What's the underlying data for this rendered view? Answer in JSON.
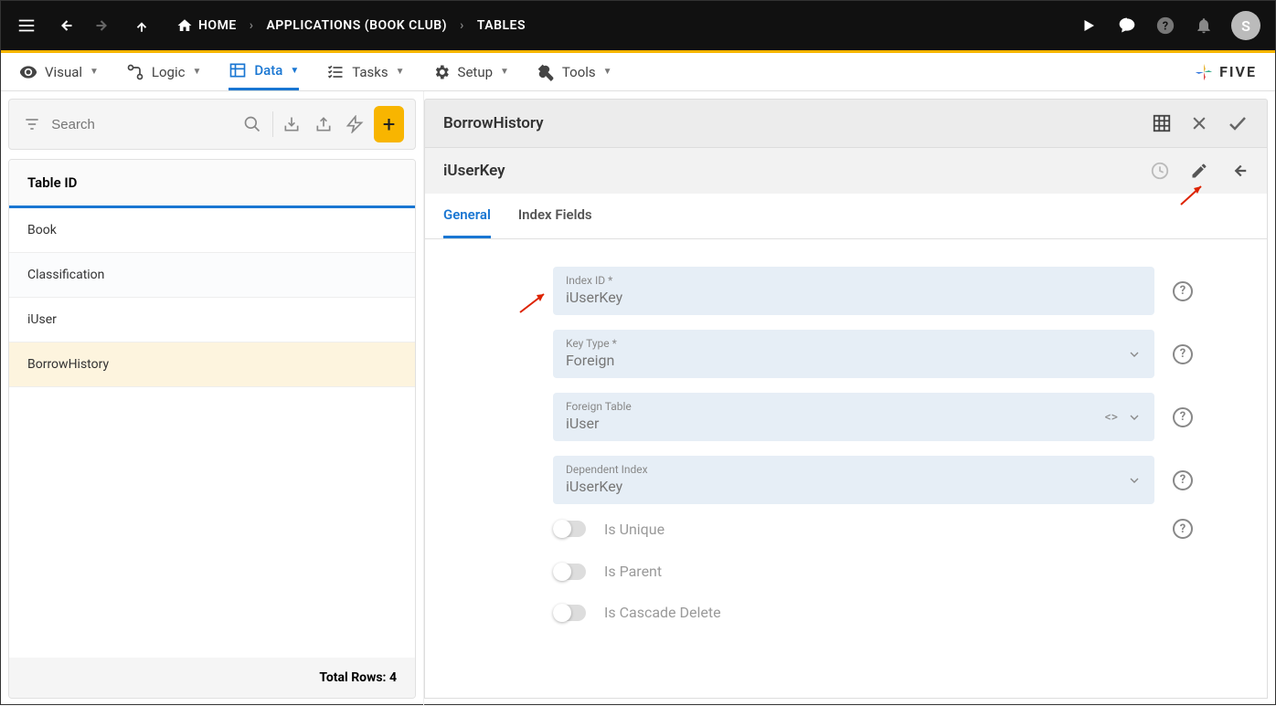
{
  "topbar": {
    "home": "HOME",
    "crumb_app": "APPLICATIONS (BOOK CLUB)",
    "crumb_tables": "TABLES",
    "avatar_initial": "S"
  },
  "tabs": {
    "visual": "Visual",
    "logic": "Logic",
    "data": "Data",
    "tasks": "Tasks",
    "setup": "Setup",
    "tools": "Tools"
  },
  "brand": "FIVE",
  "left": {
    "search_placeholder": "Search",
    "header": "Table ID",
    "items": [
      "Book",
      "Classification",
      "iUser",
      "BorrowHistory"
    ],
    "footer": "Total Rows: 4"
  },
  "right": {
    "title": "BorrowHistory",
    "subtitle": "iUserKey",
    "subtabs": {
      "general": "General",
      "index_fields": "Index Fields"
    }
  },
  "form": {
    "index_id": {
      "label": "Index ID *",
      "value": "iUserKey"
    },
    "key_type": {
      "label": "Key Type *",
      "value": "Foreign"
    },
    "foreign_table": {
      "label": "Foreign Table",
      "value": "iUser"
    },
    "dependent_index": {
      "label": "Dependent Index",
      "value": "iUserKey"
    },
    "is_unique": "Is Unique",
    "is_parent": "Is Parent",
    "is_cascade": "Is Cascade Delete"
  }
}
